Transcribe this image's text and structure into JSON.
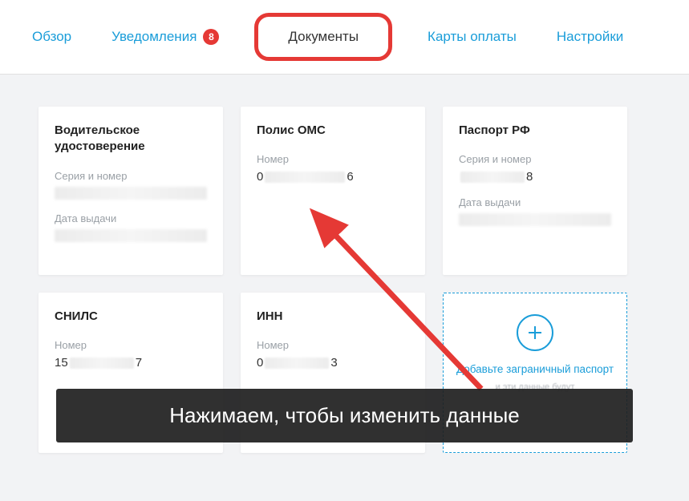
{
  "tabs": {
    "overview": "Обзор",
    "notifications": "Уведомления",
    "notifications_badge": "8",
    "documents": "Документы",
    "cards": "Карты оплаты",
    "settings": "Настройки"
  },
  "cards": {
    "driver": {
      "title": "Водительское удостоверение",
      "series_label": "Серия и номер",
      "issued_label": "Дата выдачи"
    },
    "oms": {
      "title": "Полис ОМС",
      "number_label": "Номер",
      "number_prefix": "0",
      "number_suffix": "6"
    },
    "passport": {
      "title": "Паспорт РФ",
      "series_label": "Серия и номер",
      "series_suffix": "8",
      "issued_label": "Дата выдачи"
    },
    "snils": {
      "title": "СНИЛС",
      "number_label": "Номер",
      "number_prefix": "15",
      "number_suffix": "7"
    },
    "inn": {
      "title": "ИНН",
      "number_label": "Номер",
      "number_prefix": "0",
      "number_suffix": "3"
    },
    "add": {
      "title": "Добавьте заграничный паспорт",
      "sub": "и эти данные будут"
    }
  },
  "caption": "Нажимаем, чтобы изменить данные"
}
